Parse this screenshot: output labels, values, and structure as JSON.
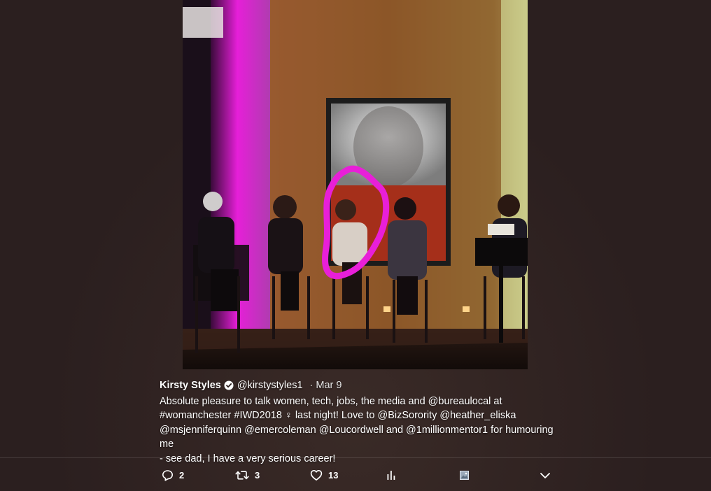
{
  "tweet": {
    "display_name": "Kirsty Styles",
    "handle": "@kirstystyles1",
    "separator": "·",
    "timestamp": "Mar 9",
    "verified_icon": "verified-badge-icon",
    "lines": [
      "Absolute pleasure to talk women, tech, jobs, the media and @bureaulocal at",
      "#womanchester #IWD2018 ♀ last night! Love to @BizSorority @heather_eliska",
      "@msjenniferquinn @emercoleman @Loucordwell and @1millionmentor1 for humouring me",
      "- see dad, I have a very serious career!"
    ]
  },
  "photo": {
    "highlight_color": "#e81fd8",
    "wall_color": "#8a5a2e",
    "left_light_color": "#d21fd0"
  },
  "actions": {
    "reply": {
      "icon": "reply-icon",
      "count": "2"
    },
    "retweet": {
      "icon": "retweet-icon",
      "count": "3"
    },
    "like": {
      "icon": "heart-icon",
      "count": "13"
    },
    "analytics": {
      "icon": "analytics-icon"
    },
    "media": {
      "icon": "image-icon"
    },
    "more": {
      "icon": "chevron-down-icon"
    }
  }
}
